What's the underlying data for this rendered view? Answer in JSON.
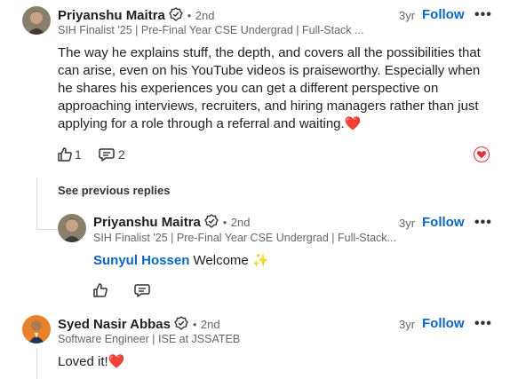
{
  "comment1": {
    "author": "Priyanshu Maitra",
    "degree": "2nd",
    "headline": "SIH Finalist '25 | Pre-Final Year CSE Undergrad | Full-Stack ...",
    "time": "3yr",
    "follow_label": "Follow",
    "more_icon": "•••",
    "text": "The way he explains stuff, the depth, and covers all the possibilities that can arise, even on his YouTube videos is praiseworthy. Especially when he shares his experiences you can get a different perspective on approaching interviews, recruiters, and hiring managers rather than just applying for a role through a referral and waiting.❤️",
    "like_count": "1",
    "reply_count": "2",
    "see_previous": "See previous replies"
  },
  "reply1": {
    "author": "Priyanshu Maitra",
    "degree": "2nd",
    "headline": "SIH Finalist '25 | Pre-Final Year CSE Undergrad | Full-Stack...",
    "time": "3yr",
    "follow_label": "Follow",
    "more_icon": "•••",
    "mention": "Sunyul Hossen",
    "text": " Welcome ",
    "emoji": "✨"
  },
  "comment2": {
    "author": "Syed Nasir Abbas",
    "degree": "2nd",
    "headline": "Software Engineer | ISE at JSSATEB",
    "time": "3yr",
    "follow_label": "Follow",
    "more_icon": "•••",
    "text": "Loved it!❤️"
  },
  "colors": {
    "accent": "#0a66c2",
    "heart": "#e7323c"
  }
}
